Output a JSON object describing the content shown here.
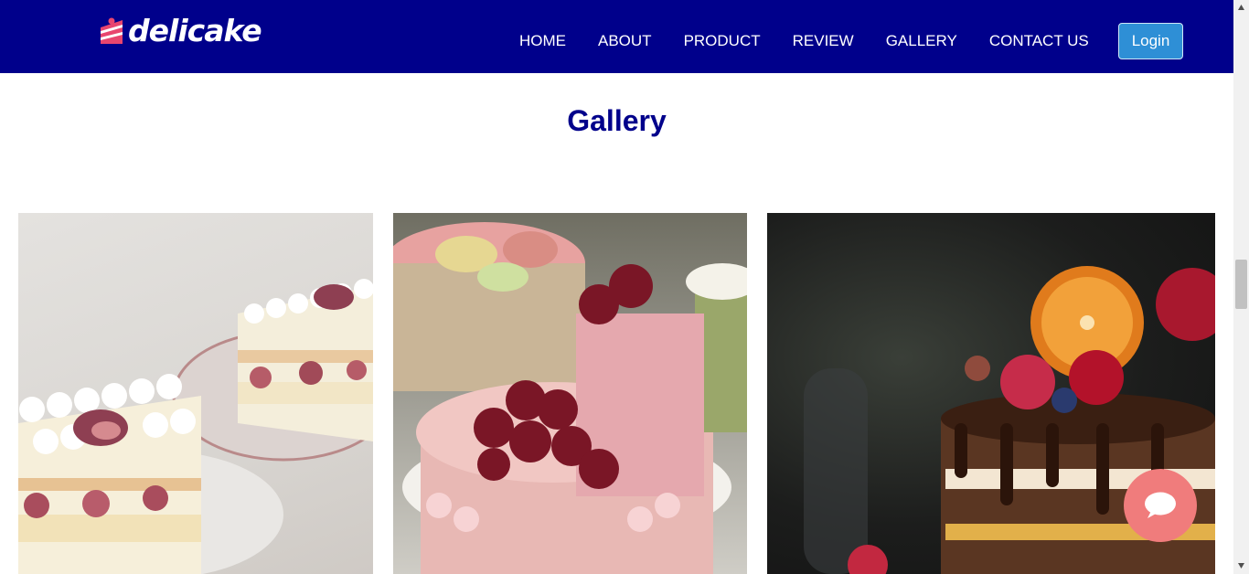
{
  "brand": {
    "name": "delicake",
    "logo_icon": "cake-slice-icon"
  },
  "nav": {
    "items": [
      {
        "label": "HOME"
      },
      {
        "label": "ABOUT"
      },
      {
        "label": "PRODUCT"
      },
      {
        "label": "REVIEW"
      },
      {
        "label": "GALLERY"
      },
      {
        "label": "CONTACT US"
      }
    ],
    "login_label": "Login"
  },
  "gallery": {
    "title": "Gallery",
    "images": [
      {
        "subject": "fig and cream sponge cake slices"
      },
      {
        "subject": "strawberry crepe cake"
      },
      {
        "subject": "chocolate drip cake with orange and berries"
      }
    ]
  },
  "chat": {
    "icon": "chat-bubble-icon"
  },
  "colors": {
    "navbar": "#00008b",
    "title": "#00008b",
    "login_button": "#2e8fd6",
    "chat_button": "#f07c7c",
    "logo_accent": "#e8456f"
  }
}
